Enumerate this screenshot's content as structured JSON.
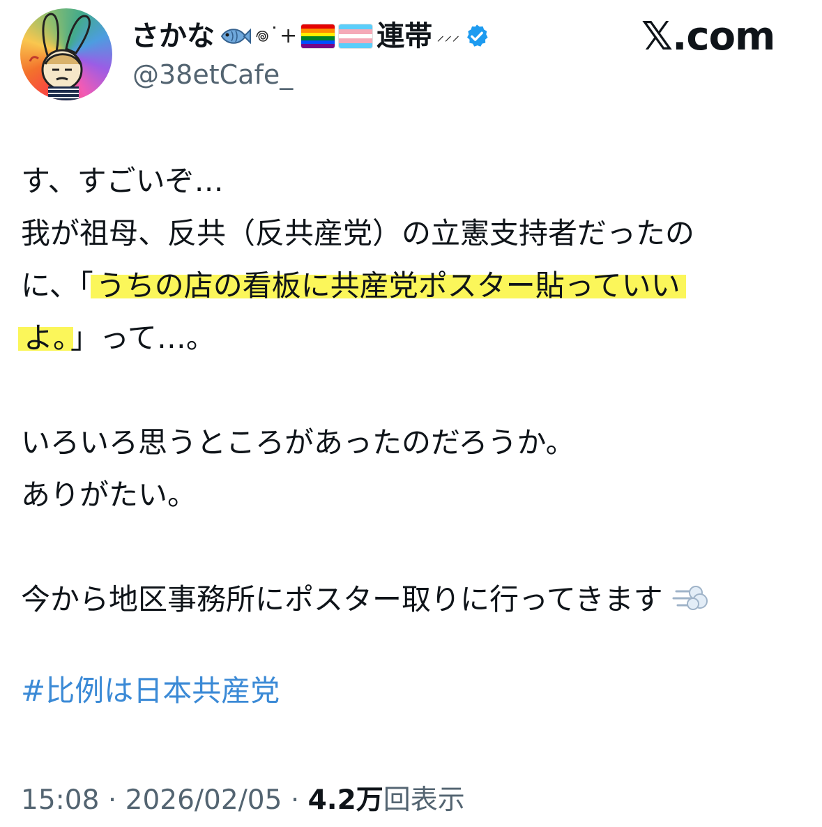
{
  "author": {
    "name": "さかな",
    "name_decor": "𖦹",
    "name_suffix": "連帯",
    "name_tail": "⸝⸝⸝",
    "handle": "@38etCafe_",
    "verified": true
  },
  "brand": {
    "logo_text": "𝕏.com"
  },
  "tweet": {
    "lines": [
      "す、すごいぞ…",
      "我が祖母、反共（反共産党）の立憲支持者だったの"
    ],
    "line3_prefix": "に、「",
    "line3_highlight": "うちの店の看板に共産党ポスター貼っていい",
    "line4_highlight": "よ。",
    "line4_rest": "」って…。",
    "line5": "いろいろ思うところがあったのだろうか。",
    "line6": "ありがたい。",
    "line7": "今から地区事務所にポスター取りに行ってきます",
    "hashtag": "#比例は日本共産党"
  },
  "meta": {
    "time": "15:08",
    "date": "2026/02/05",
    "separator": "·",
    "views_count": "4.2万",
    "views_label": "回表示"
  },
  "colors": {
    "text": "#0f1419",
    "secondary": "#536471",
    "link": "#3b8ad6",
    "highlight": "#fbf65a",
    "verified": "#1d9bf0"
  },
  "icons": {
    "avatar": "rainbow-rabbit-avatar",
    "fish": "fish-icon",
    "sparkle": "sparkle-icon",
    "pride_flag": "rainbow-flag-icon",
    "trans_flag": "transgender-flag-icon",
    "verified": "verified-badge-icon",
    "dash": "dashing-away-icon"
  }
}
